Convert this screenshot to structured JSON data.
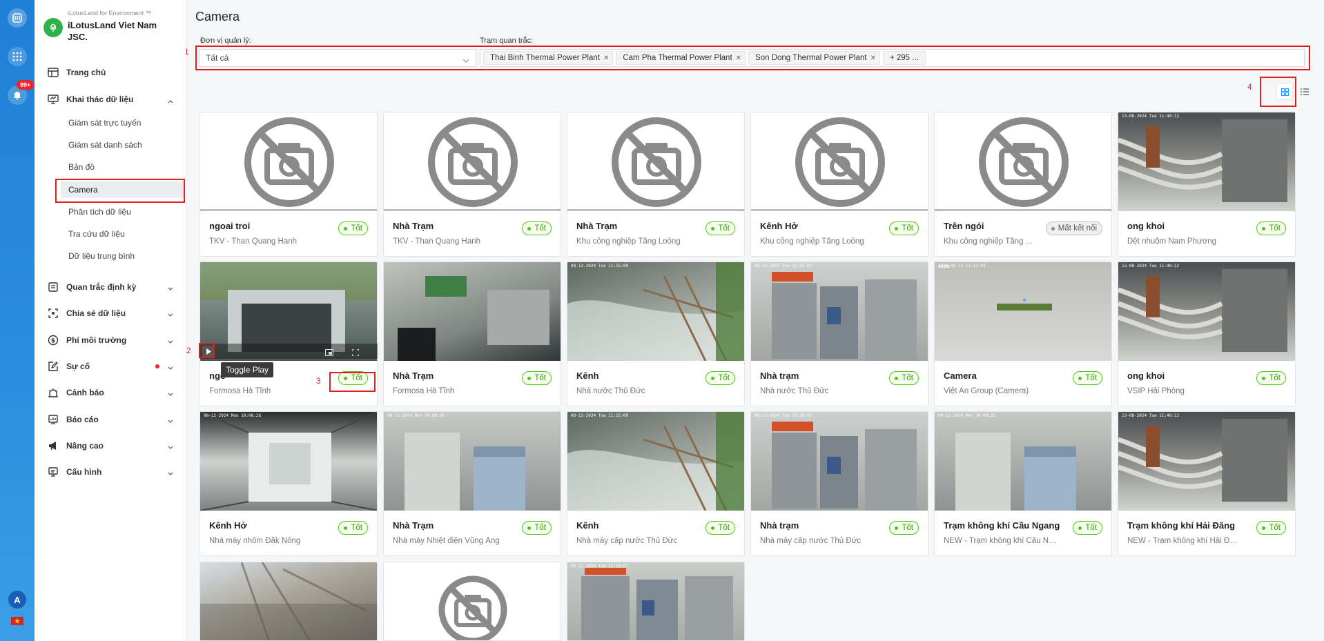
{
  "rail": {
    "badge_count": "99+",
    "avatar_letter": "A"
  },
  "org": {
    "sub": "iLotusLand for Environment ™",
    "name": "iLotusLand Viet Nam JSC."
  },
  "nav": {
    "home": "Trang chủ",
    "data_mining": "Khai thác dữ liệu",
    "sub": [
      "Giám sát trực tuyến",
      "Giám sát danh sách",
      "Bản đồ",
      "Camera",
      "Phân tích dữ liệu",
      "Tra cứu dữ liệu",
      "Dữ liệu trung bình"
    ],
    "periodic": "Quan trắc định kỳ",
    "share": "Chia sẻ dữ liệu",
    "fee": "Phí môi trường",
    "incident": "Sự cố",
    "alert": "Cảnh báo",
    "report": "Báo cáo",
    "advanced": "Nâng cao",
    "config": "Cấu hình"
  },
  "page": {
    "title": "Camera"
  },
  "filters": {
    "unit_label": "Đơn vị quản lý:",
    "unit_value": "Tất cả",
    "station_label": "Trạm quan trắc:",
    "tags": [
      "Thai Binh Thermal Power Plant",
      "Cam Pha Thermal Power Plant",
      "Son Dong Thermal Power Plant"
    ],
    "more": "+ 295 ..."
  },
  "annotations": {
    "a1": "1",
    "a2": "2",
    "a3": "3",
    "a4": "4"
  },
  "tooltip": "Toggle Play",
  "status": {
    "ok": "Tốt",
    "offline": "Mất kết nối"
  },
  "cards": [
    {
      "title": "ngoai troi",
      "subtitle": "TKV - Than Quang Hanh",
      "status": "Tốt"
    },
    {
      "title": "Nhà Trạm",
      "subtitle": "TKV - Than Quang Hanh",
      "status": "Tốt"
    },
    {
      "title": "Nhà Trạm",
      "subtitle": "Khu công nghiệp Tằng Loỏng",
      "status": "Tốt"
    },
    {
      "title": "Kênh Hở",
      "subtitle": "Khu công nghiệp Tằng Loỏng",
      "status": "Tốt"
    },
    {
      "title": "Trên ngói",
      "subtitle": "Khu công nghiệp Tằng ...",
      "status": "Mất kết nối"
    },
    {
      "title": "ong khoi",
      "subtitle": "Dệt nhuộm Nam Phương",
      "status": "Tốt"
    },
    {
      "title": "ngo",
      "subtitle": "Formosa Hà Tĩnh",
      "status": "Tốt"
    },
    {
      "title": "Nhà Trạm",
      "subtitle": "Formosa Hà Tĩnh",
      "status": "Tốt"
    },
    {
      "title": "Kênh",
      "subtitle": "Nhà nước Thủ Đức",
      "status": "Tốt"
    },
    {
      "title": "Nhà trạm",
      "subtitle": "Nhà nước Thủ Đức",
      "status": "Tốt"
    },
    {
      "title": "Camera",
      "subtitle": "Việt An Group (Camera)",
      "status": "Tốt"
    },
    {
      "title": "ong khoi",
      "subtitle": "VSIP Hải Phòng",
      "status": "Tốt"
    },
    {
      "title": "Kênh Hở",
      "subtitle": "Nhà máy nhôm Đăk Nông",
      "status": "Tốt"
    },
    {
      "title": "Nhà Trạm",
      "subtitle": "Nhà máy Nhiệt điện Vũng Áng",
      "status": "Tốt"
    },
    {
      "title": "Kênh",
      "subtitle": "Nhà máy cấp nước Thủ Đức",
      "status": "Tốt"
    },
    {
      "title": "Nhà trạm",
      "subtitle": "Nhà máy cấp nước Thủ Đức",
      "status": "Tốt"
    },
    {
      "title": "Trạm không khí Cầu Ngang",
      "subtitle": "NEW - Trạm không khí Cầu Ng...",
      "status": "Tốt"
    },
    {
      "title": "Trạm không khí Hải Đăng",
      "subtitle": "NEW - Trạm không khí Hải Đăng",
      "status": "Tốt"
    }
  ],
  "overlay_text": {
    "ts1": "13-08-2024 Tue 11:40:12",
    "ts2": "08-13-2024 Tue 11:15:09",
    "ts3": "08-13-2024 Tue 11:19:02",
    "ts4": "08-12-2024 Mon 10:08:25",
    "ts5": "08-12-2024 Mon 10:08:26",
    "ts6": "2024-08-13 11:11:03",
    "brand": "ezviz"
  }
}
